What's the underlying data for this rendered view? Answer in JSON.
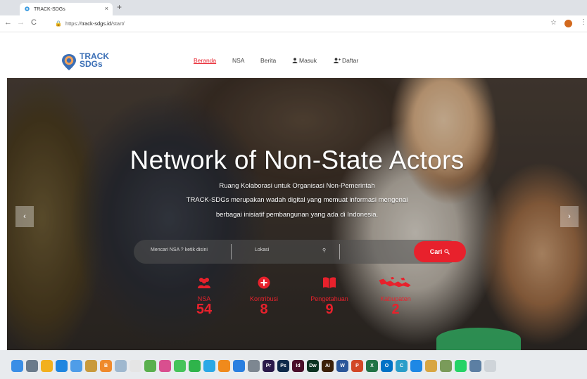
{
  "browser": {
    "tab_title": "TRACK-SDGs",
    "tab_close": "×",
    "new_tab": "+",
    "url_scheme": "https://",
    "url_host": "track-sdgs.id",
    "url_path": "/start/"
  },
  "site": {
    "logo_line1": "TRACK",
    "logo_line2": "SDGs",
    "nav": {
      "beranda": "Beranda",
      "nsa": "NSA",
      "berita": "Berita",
      "masuk": "Masuk",
      "daftar": "Daftar"
    }
  },
  "hero": {
    "title": "Network of Non-State Actors",
    "subtitle_line1": "Ruang Kolaborasi untuk Organisasi Non-Pemerintah",
    "subtitle_line2": "TRACK-SDGs merupakan wadah digital yang memuat informasi mengenai",
    "subtitle_line3": "berbagai inisiatif pembangunan yang ada di Indonesia.",
    "prev_arrow": "‹",
    "next_arrow": "›"
  },
  "search": {
    "nsa_placeholder": "Mencari NSA ? ketik disini",
    "lokasi_placeholder": "Lokasi",
    "button_label": "Cari"
  },
  "stats": [
    {
      "label": "NSA",
      "value": "54",
      "icon": "users-icon"
    },
    {
      "label": "Kontribusi",
      "value": "8",
      "icon": "plus-circle-icon"
    },
    {
      "label": "Pengetahuan",
      "value": "9",
      "icon": "book-icon"
    },
    {
      "label": "Kabupaten",
      "value": "2",
      "icon": "map-icon"
    }
  ],
  "dock": {
    "apps": [
      {
        "name": "finder",
        "color": "#3a8ee6",
        "text": ""
      },
      {
        "name": "launchpad",
        "color": "#6a7b8c",
        "text": ""
      },
      {
        "name": "chrome",
        "color": "#f2b01e",
        "text": ""
      },
      {
        "name": "safari",
        "color": "#1f86e0",
        "text": ""
      },
      {
        "name": "mail",
        "color": "#4f9de8",
        "text": ""
      },
      {
        "name": "notes",
        "color": "#c99a3b",
        "text": ""
      },
      {
        "name": "blogger",
        "color": "#ef8a2c",
        "text": "B"
      },
      {
        "name": "preview",
        "color": "#9fb8cf",
        "text": ""
      },
      {
        "name": "textedit",
        "color": "#e5e5e5",
        "text": ""
      },
      {
        "name": "maps",
        "color": "#5ab04e",
        "text": ""
      },
      {
        "name": "photos",
        "color": "#d94f8f",
        "text": ""
      },
      {
        "name": "messages",
        "color": "#46c35a",
        "text": ""
      },
      {
        "name": "facetime",
        "color": "#2fb44b",
        "text": ""
      },
      {
        "name": "itunes",
        "color": "#2aa8e6",
        "text": ""
      },
      {
        "name": "ibooks",
        "color": "#f08a1c",
        "text": ""
      },
      {
        "name": "appstore",
        "color": "#2a7fe0",
        "text": ""
      },
      {
        "name": "settings",
        "color": "#7d8791",
        "text": ""
      },
      {
        "name": "premiere",
        "color": "#2a1a4a",
        "text": "Pr"
      },
      {
        "name": "photoshop",
        "color": "#0e2a4a",
        "text": "Ps"
      },
      {
        "name": "indesign",
        "color": "#4a0f2a",
        "text": "Id"
      },
      {
        "name": "dreamweaver",
        "color": "#0b3322",
        "text": "Dw"
      },
      {
        "name": "illustrator",
        "color": "#3b2009",
        "text": "Ai"
      },
      {
        "name": "word",
        "color": "#2b579a",
        "text": "W"
      },
      {
        "name": "powerpoint",
        "color": "#d24726",
        "text": "P"
      },
      {
        "name": "excel",
        "color": "#217346",
        "text": "X"
      },
      {
        "name": "outlook",
        "color": "#0072c6",
        "text": "O"
      },
      {
        "name": "camtasia",
        "color": "#2a9ec9",
        "text": "C"
      },
      {
        "name": "teamviewer",
        "color": "#1e88e5",
        "text": ""
      },
      {
        "name": "books",
        "color": "#d8a642",
        "text": ""
      },
      {
        "name": "grapher",
        "color": "#7a9b5a",
        "text": ""
      },
      {
        "name": "whatsapp",
        "color": "#25d366",
        "text": ""
      },
      {
        "name": "monitor",
        "color": "#5c7fa3",
        "text": ""
      },
      {
        "name": "trash",
        "color": "#cfd4d9",
        "text": ""
      }
    ]
  },
  "colors": {
    "accent": "#e8212c",
    "logo_blue": "#3b6fb6"
  }
}
